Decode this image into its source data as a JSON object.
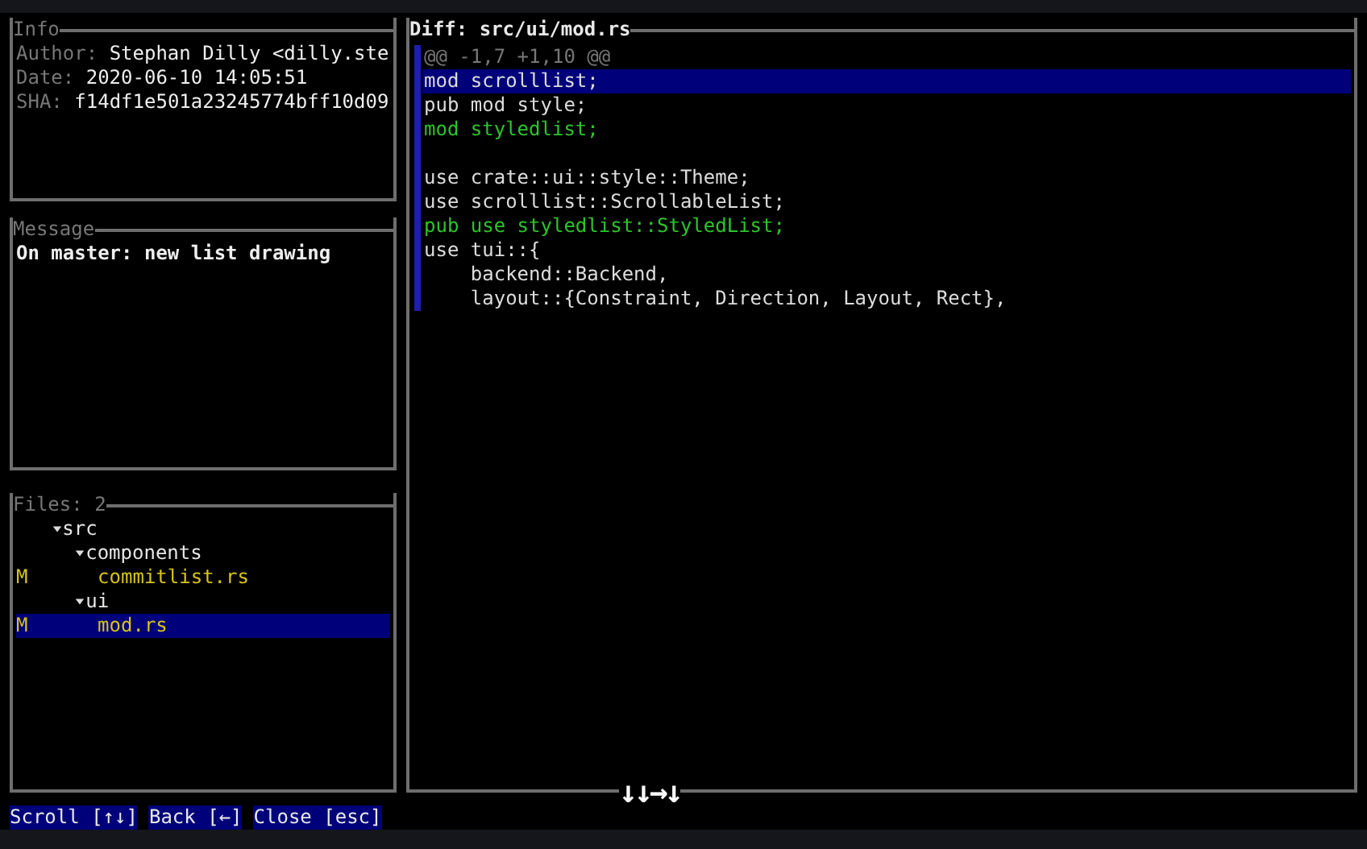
{
  "info": {
    "title": "Info",
    "fields": [
      {
        "label": "Author:",
        "value": "Stephan Dilly <dilly.ste"
      },
      {
        "label": "Date:",
        "value": "2020-06-10 14:05:51"
      },
      {
        "label": "SHA:",
        "value": "f14df1e501a23245774bff10d09"
      }
    ]
  },
  "message": {
    "title": "Message",
    "text": "On master: new list drawing"
  },
  "files": {
    "title": "Files: 2",
    "tree": [
      {
        "name": "src",
        "kind": "folder",
        "expanded": true,
        "children": [
          {
            "name": "components",
            "kind": "folder",
            "expanded": true,
            "children": [
              {
                "name": "commitlist.rs",
                "kind": "file",
                "status": "M",
                "selected": false
              }
            ]
          },
          {
            "name": "ui",
            "kind": "folder",
            "expanded": true,
            "children": [
              {
                "name": "mod.rs",
                "kind": "file",
                "status": "M",
                "selected": true
              }
            ]
          }
        ]
      }
    ]
  },
  "diff": {
    "title": "Diff: src/ui/mod.rs",
    "blocks": [
      {
        "lines": [
          {
            "kind": "header",
            "text": "@@ -1,7 +1,10 @@",
            "selected": false
          },
          {
            "kind": "context",
            "text": "mod scrolllist;",
            "selected": true
          },
          {
            "kind": "context",
            "text": "pub mod style;",
            "selected": false
          },
          {
            "kind": "add",
            "text": "mod styledlist;",
            "selected": false
          }
        ]
      },
      {
        "lines": [
          {
            "kind": "context",
            "text": "use crate::ui::style::Theme;",
            "selected": false
          },
          {
            "kind": "context",
            "text": "use scrolllist::ScrollableList;",
            "selected": false
          },
          {
            "kind": "add",
            "text": "pub use styledlist::StyledList;",
            "selected": false
          },
          {
            "kind": "context",
            "text": "use tui::{",
            "selected": false
          },
          {
            "kind": "context",
            "text": "    backend::Backend,",
            "selected": false
          },
          {
            "kind": "context",
            "text": "    layout::{Constraint, Direction, Layout, Rect},",
            "selected": false
          }
        ]
      }
    ]
  },
  "key_overlay": "↓↓→↓",
  "commands": [
    "Scroll [↑↓]",
    "Back [←]",
    "Close [esc]"
  ]
}
